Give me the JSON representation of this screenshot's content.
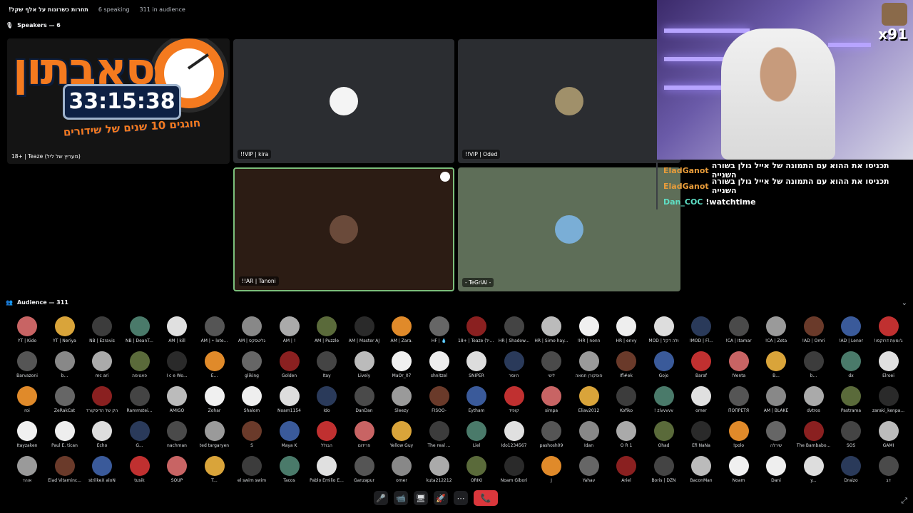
{
  "topbar": {
    "channel_title": "!תחרות כשרונות על אלף שקל",
    "speaking": "6 speaking",
    "audience": "311 in audience"
  },
  "speakers": {
    "label": "Speakers — 6",
    "logo": {
      "word": "סאבתון",
      "timer": "33:15:38",
      "subtitle": "חוגגים 10 שנים של שידורים",
      "name": "18+ | Teaze (מעריץ של ליל)"
    },
    "tiles": [
      {
        "name": "!!VIP | kira",
        "color": "#f4f4f4"
      },
      {
        "name": "!!VIP | Oded",
        "color": "#a0906a"
      },
      {
        "name": "!!AR | Tanoni",
        "color": "#6a4a3a"
      },
      {
        "name": "- TeGriAi -",
        "color": "#7aaed6"
      }
    ]
  },
  "chat": [
    {
      "user": "EladGanot",
      "text": "תכניסו את ההוא עם התמונה של אייל גולן בשורה השנייה"
    },
    {
      "user": "EladGanot",
      "text": "תכניסו את ההוא עם התמונה של אייל גולן בשורה השנייה"
    },
    {
      "user": "Dan_COC",
      "text": "!watchtime"
    }
  ],
  "webcam": {
    "badge": "x91"
  },
  "audience": {
    "label": "Audience — 311",
    "rows": [
      [
        "YT | Kido",
        "YT | Neriya",
        "NB | Ezravis",
        "NB | DeanT...",
        "AM | kill",
        "AM | • lote...",
        "AM | גליטסקס",
        "AM | !",
        "AM | Puzzle",
        "AM | Master AJ",
        "AM | Zara.",
        "HF | 💧",
        "18+ | Teaze (ליל...",
        "HR | Shadow...",
        "HR | Simo hay...",
        "!HR | nonn",
        "HR | envy",
        "MOD | ולה דקל",
        "!MOD | Fl...",
        "!CA | Itamar",
        "!CA | Zeta",
        "!AD | Omri",
        "!AD | Lenor",
        "!ג'ומעת דרוקסו"
      ],
      [
        "Barvazoni",
        "b...",
        "mc ari",
        "פאטימה",
        "I c e Wo...",
        "E...",
        "gliking",
        "Golden",
        "Itay",
        "Lively",
        "MaOr_07",
        "shnitzel",
        "SNIPER",
        "היוסר",
        "ליטי",
        "פופקורן חמאה",
        "Ifl#ek",
        "Gojo",
        "Baraf",
        "!Venta",
        "B...",
        "b...",
        "dx",
        "Elroei"
      ],
      [
        "roi",
        "ZeRakCat",
        "הק של הדיסקורד",
        "Rammstei...",
        "AMIGO",
        "Zohar",
        "Shalom",
        "Noam1154",
        "Ido",
        "DanDan",
        "Sleezy",
        "FISOO-",
        "Eytham",
        "קופיד",
        "simpa",
        "Eliav2012",
        "Kofiko",
        "! zivvvvv",
        "omer",
        "ПОПРЕТЯ",
        "AM | BLAKE",
        "dvtros",
        "Pastrama",
        "zaraki_kenpa..."
      ],
      [
        "Itayzaken",
        "Paul E. tican",
        "Echo",
        "G...",
        "nachman",
        "ted targaryen",
        "S",
        "Maya K",
        "הבולל",
        "פרידום",
        "Yellow Guy",
        "The real ...",
        "Liel",
        "Ido1234567",
        "pashosh09",
        "Idan",
        "O R 1",
        "Ohad",
        "Efi NaNa",
        "!polo",
        "שירלה",
        "The Bambabo...",
        "SOS",
        "GAMI"
      ],
      [
        "אוהד",
        "Elad Vitaminc...",
        "strilkeX aloN",
        "tusik",
        "SOUP",
        "T...",
        "el swim swim",
        "Tacos",
        "Pablo Emilio E...",
        "Ganzapur",
        "omer",
        "kuta212212",
        "ORIKI",
        "Noam Gibori",
        "J",
        "Yahav",
        "Ariel",
        "Boris | DZN",
        "BaconMan",
        "Noam",
        "Dani",
        "y...",
        "Draizo",
        "דב"
      ]
    ],
    "colors": [
      "#c86464",
      "#d9a43a",
      "#3c3c3c",
      "#4a7a6a",
      "#e0e0e0",
      "#555",
      "#888",
      "#aaa",
      "#5a6a3a",
      "#2a2a2a",
      "#e08a2a",
      "#666",
      "#8a2020",
      "#444",
      "#bbb",
      "#f0f0f0",
      "#eee",
      "#ddd",
      "#2a3a5a",
      "#4a4a4a",
      "#9a9a9a",
      "#6a3a2a",
      "#3a5a9a",
      "#c03030"
    ]
  },
  "controls": {
    "mic": "🎤",
    "video": "📹",
    "share": "🖥",
    "activity": "🚀",
    "more": "⋯",
    "hangup": "📞"
  }
}
